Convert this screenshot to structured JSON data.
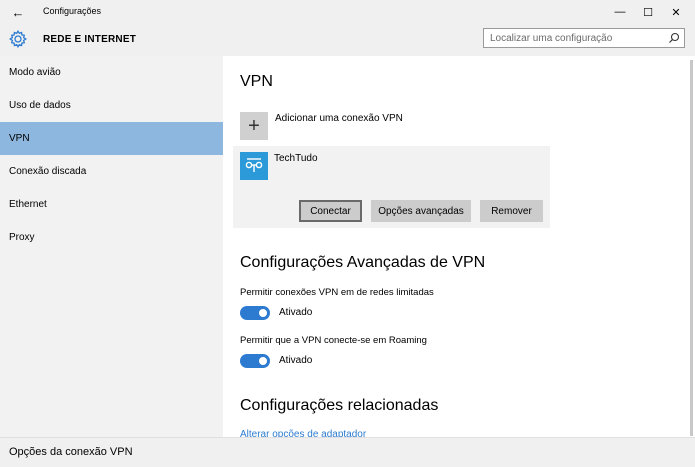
{
  "window": {
    "title": "Configurações",
    "back_icon": "←",
    "minimize_icon": "—",
    "maximize_icon": "☐",
    "close_icon": "✕"
  },
  "header": {
    "section_title": "REDE E INTERNET",
    "search_placeholder": "Localizar uma configuração"
  },
  "sidebar": {
    "items": [
      {
        "label": "Modo avião"
      },
      {
        "label": "Uso de dados"
      },
      {
        "label": "VPN"
      },
      {
        "label": "Conexão discada"
      },
      {
        "label": "Ethernet"
      },
      {
        "label": "Proxy"
      }
    ],
    "active_index": 2
  },
  "main": {
    "vpn_heading": "VPN",
    "add_icon": "+",
    "add_label": "Adicionar uma conexão VPN",
    "connection": {
      "name": "TechTudo",
      "buttons": {
        "connect": "Conectar",
        "advanced": "Opções avançadas",
        "remove": "Remover"
      }
    },
    "advanced_heading": "Configurações Avançadas de VPN",
    "options": [
      {
        "label": "Permitir conexões VPN em de redes limitadas",
        "state": "Ativado"
      },
      {
        "label": "Permitir que a VPN conecte-se em Roaming",
        "state": "Ativado"
      }
    ],
    "related_heading": "Configurações relacionadas",
    "related_link": "Alterar opções de adaptador"
  },
  "status": {
    "text": "Opções da conexão VPN"
  },
  "colors": {
    "accent": "#2c7bd0",
    "active_nav": "#8db7de",
    "vpn_icon_bg": "#2c9ad8"
  }
}
